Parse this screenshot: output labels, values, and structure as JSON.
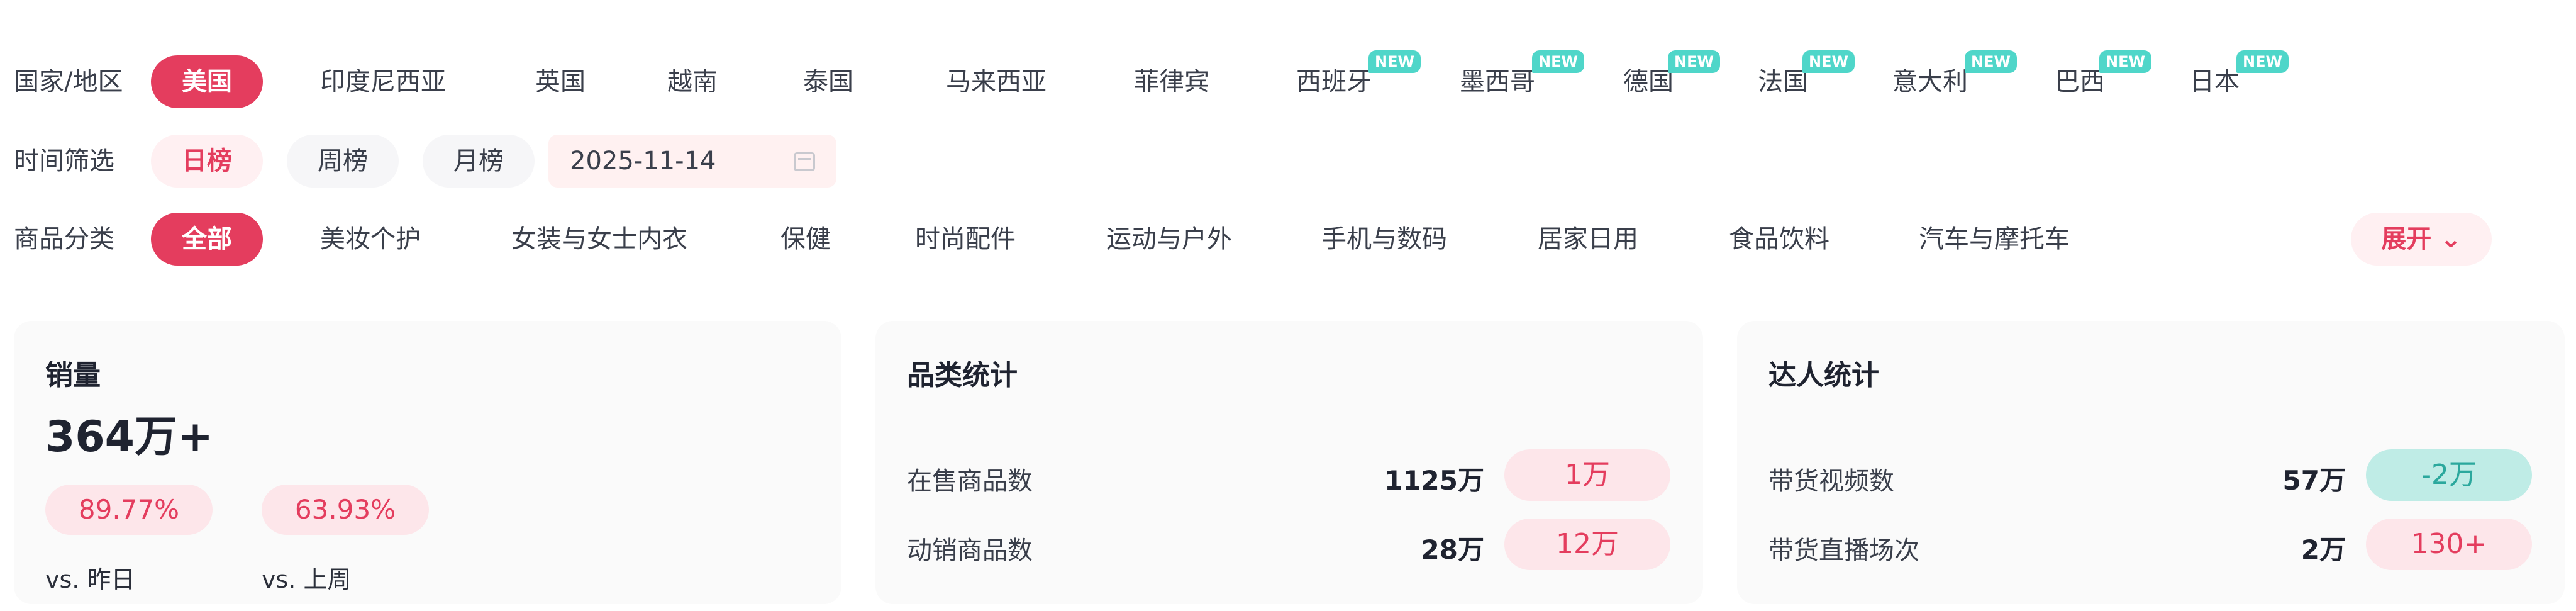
{
  "filters": {
    "country": {
      "label": "国家/地区",
      "items": [
        {
          "label": "美国",
          "active": true
        },
        {
          "label": "印度尼西亚"
        },
        {
          "label": "英国"
        },
        {
          "label": "越南"
        },
        {
          "label": "泰国"
        },
        {
          "label": "马来西亚"
        },
        {
          "label": "菲律宾"
        },
        {
          "label": "西班牙",
          "badge": "NEW"
        },
        {
          "label": "墨西哥",
          "badge": "NEW"
        },
        {
          "label": "德国",
          "badge": "NEW"
        },
        {
          "label": "法国",
          "badge": "NEW"
        },
        {
          "label": "意大利",
          "badge": "NEW"
        },
        {
          "label": "巴西",
          "badge": "NEW"
        },
        {
          "label": "日本",
          "badge": "NEW"
        }
      ]
    },
    "time": {
      "label": "时间筛选",
      "items": [
        {
          "label": "日榜",
          "active": true
        },
        {
          "label": "周榜"
        },
        {
          "label": "月榜"
        }
      ],
      "date_value": "2025-11-14"
    },
    "category": {
      "label": "商品分类",
      "items": [
        {
          "label": "全部",
          "active": true
        },
        {
          "label": "美妆个护"
        },
        {
          "label": "女装与女士内衣"
        },
        {
          "label": "保健"
        },
        {
          "label": "时尚配件"
        },
        {
          "label": "运动与户外"
        },
        {
          "label": "手机与数码"
        },
        {
          "label": "居家日用"
        },
        {
          "label": "食品饮料"
        },
        {
          "label": "汽车与摩托车"
        }
      ],
      "expand_label": "展开 ⌄"
    }
  },
  "sales_card": {
    "title": "销量",
    "value": "364万+",
    "comparisons": [
      {
        "percent": "89.77%",
        "label": "vs. 昨日"
      },
      {
        "percent": "63.93%",
        "label": "vs. 上周"
      }
    ]
  },
  "category_card": {
    "title": "品类统计",
    "rows": [
      {
        "label": "在售商品数",
        "value": "1125万",
        "change": "1万"
      },
      {
        "label": "动销商品数",
        "value": "28万",
        "change": "12万"
      }
    ]
  },
  "creator_card": {
    "title": "达人统计",
    "rows": [
      {
        "label": "带货视频数",
        "value": "57万",
        "change": "-2万"
      },
      {
        "label": "带货直播场次",
        "value": "2万",
        "change": "130+"
      }
    ]
  },
  "colors": {
    "accent": "#e43d5e",
    "accent_soft": "#fde6ea",
    "badge": "#4fd6c9",
    "teal_soft": "#bfece6"
  }
}
